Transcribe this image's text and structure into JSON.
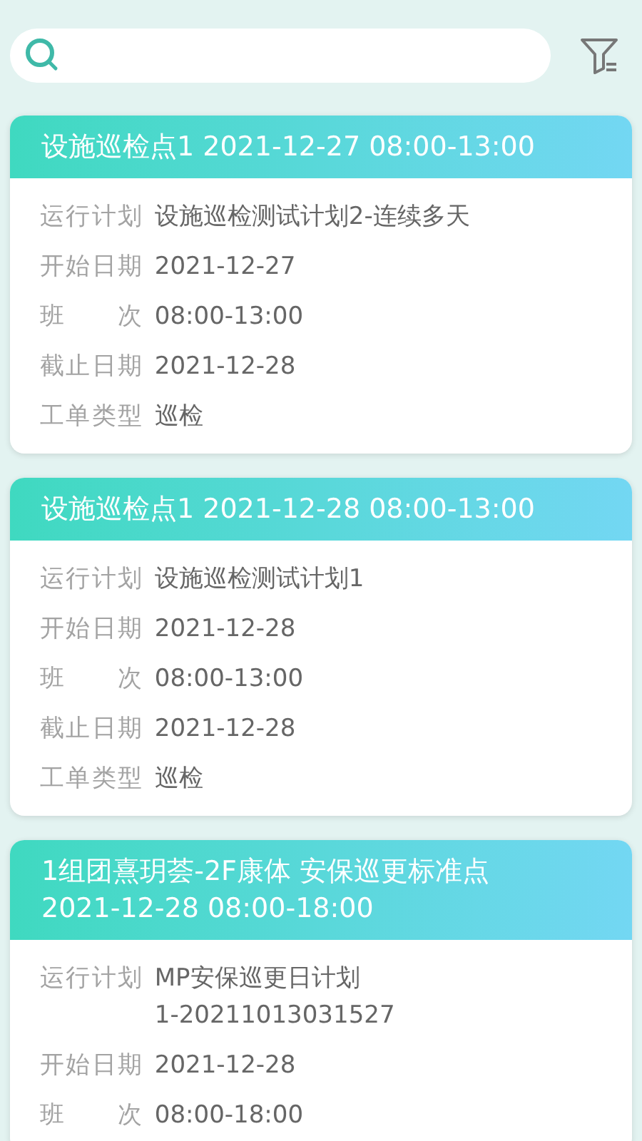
{
  "cards": [
    {
      "title_lines": [
        "设施巡检点1 2021-12-27 08:00-13:00"
      ],
      "fields": [
        {
          "label": "运行计划",
          "value_lines": [
            "设施巡检测试计划2-连续多天"
          ]
        },
        {
          "label": "开始日期",
          "value_lines": [
            "2021-12-27"
          ]
        },
        {
          "label": "班次",
          "value_lines": [
            "08:00-13:00"
          ]
        },
        {
          "label": "截止日期",
          "value_lines": [
            "2021-12-28"
          ]
        },
        {
          "label": "工单类型",
          "value_lines": [
            "巡检"
          ]
        }
      ]
    },
    {
      "title_lines": [
        "设施巡检点1 2021-12-28 08:00-13:00"
      ],
      "fields": [
        {
          "label": "运行计划",
          "value_lines": [
            "设施巡检测试计划1"
          ]
        },
        {
          "label": "开始日期",
          "value_lines": [
            "2021-12-28"
          ]
        },
        {
          "label": "班次",
          "value_lines": [
            "08:00-13:00"
          ]
        },
        {
          "label": "截止日期",
          "value_lines": [
            "2021-12-28"
          ]
        },
        {
          "label": "工单类型",
          "value_lines": [
            "巡检"
          ]
        }
      ]
    },
    {
      "title_lines": [
        "1组团熹玥荟-2F康体 安保巡更标准点",
        "2021-12-28 08:00-18:00"
      ],
      "fields": [
        {
          "label": "运行计划",
          "value_lines": [
            "MP安保巡更日计划",
            "1-20211013031527"
          ]
        },
        {
          "label": "开始日期",
          "value_lines": [
            "2021-12-28"
          ]
        },
        {
          "label": "班次",
          "value_lines": [
            "08:00-18:00"
          ]
        }
      ]
    }
  ]
}
